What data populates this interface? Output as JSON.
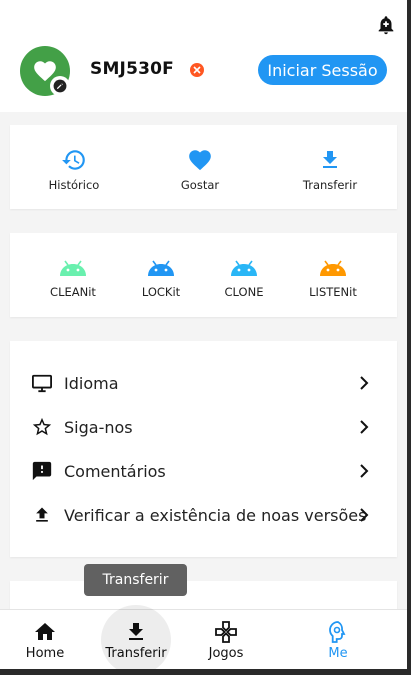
{
  "header": {
    "device_name": "SMJ530F",
    "login_label": "Iniciar Sessão",
    "bell_icon": "notification-add-icon",
    "avatar_icon": "heart-icon",
    "accent_color": "#2196f3",
    "avatar_color": "#43a047"
  },
  "quick_actions": [
    {
      "label": "Histórico",
      "icon": "history-icon"
    },
    {
      "label": "Gostar",
      "icon": "heart-icon"
    },
    {
      "label": "Transferir",
      "icon": "download-icon"
    }
  ],
  "apps": [
    {
      "label": "CLEANit",
      "icon": "android-icon",
      "color": "#69f0ae"
    },
    {
      "label": "LOCKit",
      "icon": "android-icon",
      "color": "#2196f3"
    },
    {
      "label": "CLONE",
      "icon": "android-icon",
      "color": "#29b6f6"
    },
    {
      "label": "LISTENit",
      "icon": "android-icon",
      "color": "#ff9800"
    }
  ],
  "settings": [
    {
      "label": "Idioma",
      "icon": "monitor-icon"
    },
    {
      "label": "Siga-nos",
      "icon": "star-outline-icon"
    },
    {
      "label": "Comentários",
      "icon": "feedback-icon"
    },
    {
      "label": "Verificar a existência de noas versões",
      "icon": "upload-icon"
    }
  ],
  "tooltip": "Transferir",
  "bottom_nav": [
    {
      "label": "Home",
      "icon": "home-icon",
      "active": false
    },
    {
      "label": "Transferir",
      "icon": "download-icon",
      "active": false
    },
    {
      "label": "Jogos",
      "icon": "gamepad-icon",
      "active": false
    },
    {
      "label": "Me",
      "icon": "profile-icon",
      "active": true
    }
  ]
}
